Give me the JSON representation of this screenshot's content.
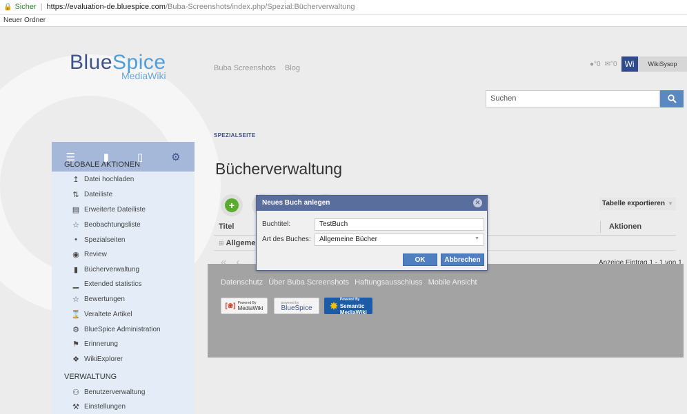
{
  "browser": {
    "secure_label": "Sicher",
    "url_host": "https://evaluation-de.bluespice.com",
    "url_path": "/Buba-Screenshots/index.php/Spezial:Bücherverwaltung",
    "bookmark": "Neuer Ordner"
  },
  "logo": {
    "blue": "Blue",
    "spice": "Spice",
    "sub": "MediaWiki"
  },
  "topnav": {
    "item1": "Buba Screenshots",
    "item2": "Blog"
  },
  "user": {
    "avatar_initials": "Wi",
    "name": "WikiSysop",
    "notif1": "0",
    "notif2": "0"
  },
  "search": {
    "placeholder": "Suchen"
  },
  "header": {
    "kicker": "SPEZIALSEITE",
    "title": "Bücherverwaltung"
  },
  "sidebar": {
    "heading_global": "GLOBALE AKTIONEN",
    "global_items": [
      {
        "label": "Datei hochladen",
        "icon": "upload-icon"
      },
      {
        "label": "Dateiliste",
        "icon": "sort-icon"
      },
      {
        "label": "Erweiterte Dateiliste",
        "icon": "list-icon"
      },
      {
        "label": "Beobachtungsliste",
        "icon": "star-icon"
      },
      {
        "label": "Spezialseiten",
        "icon": "special-icon"
      },
      {
        "label": "Review",
        "icon": "eye-icon"
      },
      {
        "label": "Bücherverwaltung",
        "icon": "book-icon"
      },
      {
        "label": "Extended statistics",
        "icon": "chart-icon"
      },
      {
        "label": "Bewertungen",
        "icon": "star-icon"
      },
      {
        "label": "Veraltete Artikel",
        "icon": "hourglass-icon"
      },
      {
        "label": "BlueSpice Administration",
        "icon": "gear-icon"
      },
      {
        "label": "Erinnerung",
        "icon": "flag-icon"
      },
      {
        "label": "WikiExplorer",
        "icon": "compass-icon"
      }
    ],
    "heading_admin": "VERWALTUNG",
    "admin_items": [
      {
        "label": "Benutzerverwaltung",
        "icon": "users-icon"
      },
      {
        "label": "Einstellungen",
        "icon": "wrench-icon"
      }
    ]
  },
  "toolbar": {
    "export_label": "Tabelle exportieren"
  },
  "grid": {
    "col_title": "Titel",
    "col_actions": "Aktionen",
    "group_row": "Allgemei",
    "page_info": "Anzeige Eintrag 1 - 1 von 1"
  },
  "footer": {
    "links": [
      "Datenschutz",
      "Über Buba Screenshots",
      "Haftungsausschluss",
      "Mobile Ansicht"
    ],
    "badge_mw_small": "Powered By",
    "badge_mw": "MediaWiki",
    "badge_bs_small": "powered by",
    "badge_bs": "BlueSpice",
    "badge_smw_small": "Powered By",
    "badge_smw1": "Semantic",
    "badge_smw2": "MediaWiki"
  },
  "dialog": {
    "title": "Neues Buch anlegen",
    "label_title": "Buchtitel:",
    "value_title": "TestBuch",
    "label_type": "Art des Buches:",
    "value_type": "Allgemeine Bücher",
    "ok": "OK",
    "cancel": "Abbrechen"
  }
}
